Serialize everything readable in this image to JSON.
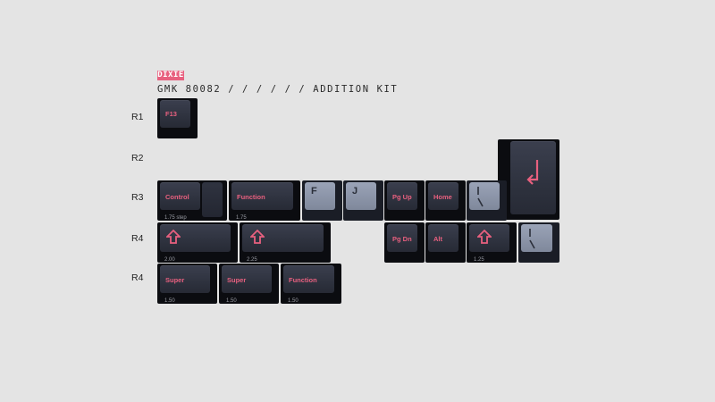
{
  "header": {
    "logo": "DIXIE",
    "title": "GMK 80082 / / / / / /  ADDITION KIT"
  },
  "rows": [
    "R1",
    "R2",
    "R3",
    "R4",
    "R4"
  ],
  "keys": {
    "f13": "F13",
    "control": "Control",
    "control_size": "1.75 step",
    "function": "Function",
    "function_size": "1.75",
    "f": "F",
    "j": "J",
    "pgup": "Pg Up",
    "home": "Home",
    "pgdn": "Pg Dn",
    "alt": "Alt",
    "shift1_size": "2.00",
    "shift2_size": "2.25",
    "shift3_size": "1.25",
    "super1": "Super",
    "super1_size": "1.50",
    "super2": "Super",
    "super2_size": "1.50",
    "function2": "Function",
    "function2_size": "1.50"
  },
  "colors": {
    "accent": "#e8607f",
    "keycap_dark": "#2c303c",
    "keycap_light": "#8f98ab",
    "background": "#e4e4e4"
  },
  "icons": [
    "shift-arrow-icon",
    "enter-arrow-icon",
    "backslash-icon"
  ]
}
